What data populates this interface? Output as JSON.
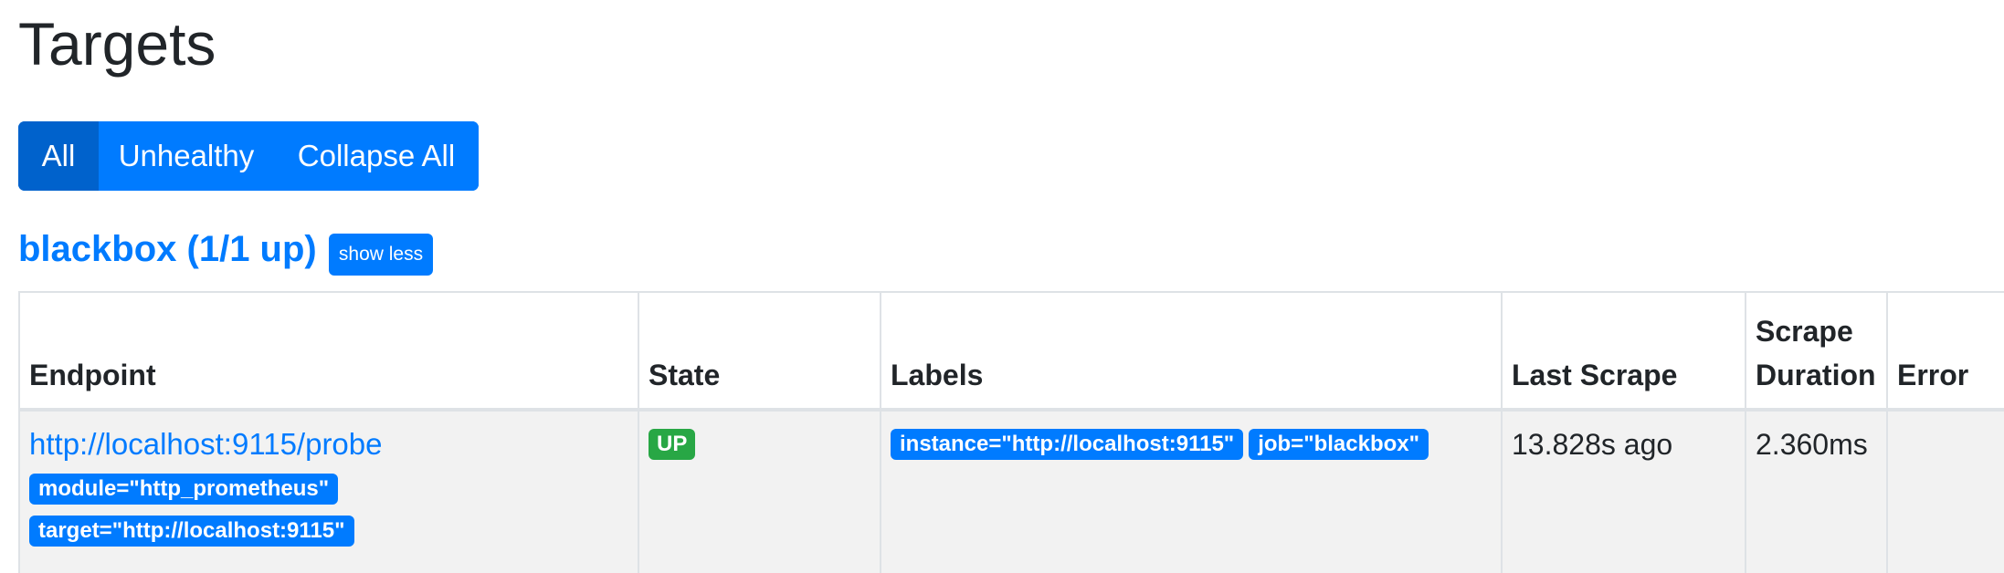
{
  "page": {
    "title": "Targets"
  },
  "filters": {
    "all_label": "All",
    "unhealthy_label": "Unhealthy",
    "collapse_label": "Collapse All"
  },
  "job": {
    "title": "blackbox (1/1 up)",
    "toggle_label": "show less"
  },
  "table": {
    "headers": {
      "endpoint": "Endpoint",
      "state": "State",
      "labels": "Labels",
      "last_scrape": "Last Scrape",
      "scrape_duration": "Scrape Duration",
      "error": "Error"
    },
    "rows": [
      {
        "endpoint": "http://localhost:9115/probe",
        "endpoint_labels": [
          "module=\"http_prometheus\"",
          "target=\"http://localhost:9115\""
        ],
        "state": "UP",
        "labels": [
          "instance=\"http://localhost:9115\"",
          "job=\"blackbox\""
        ],
        "last_scrape": "13.828s ago",
        "scrape_duration": "2.360ms",
        "error": ""
      }
    ]
  },
  "colors": {
    "primary": "#007bff",
    "primary_active": "#0062cc",
    "success": "#28a745",
    "row_bg": "#f2f2f2",
    "border": "#dee2e6"
  }
}
